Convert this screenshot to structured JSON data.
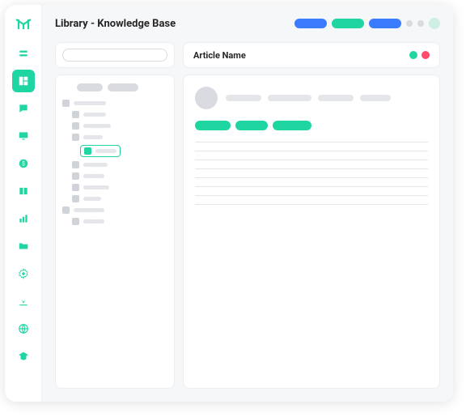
{
  "header": {
    "title": "Library - Knowledge Base"
  },
  "article": {
    "name_label": "Article Name"
  },
  "colors": {
    "accent": "#1fd6a3",
    "blue": "#3b7cff",
    "red": "#ff4a6b",
    "gray": "#d9dbe0"
  },
  "rail": {
    "items": [
      "home",
      "library",
      "chat",
      "monitor",
      "billing",
      "docs",
      "analytics",
      "files",
      "settings",
      "download",
      "globe",
      "education"
    ],
    "active_index": 1
  }
}
